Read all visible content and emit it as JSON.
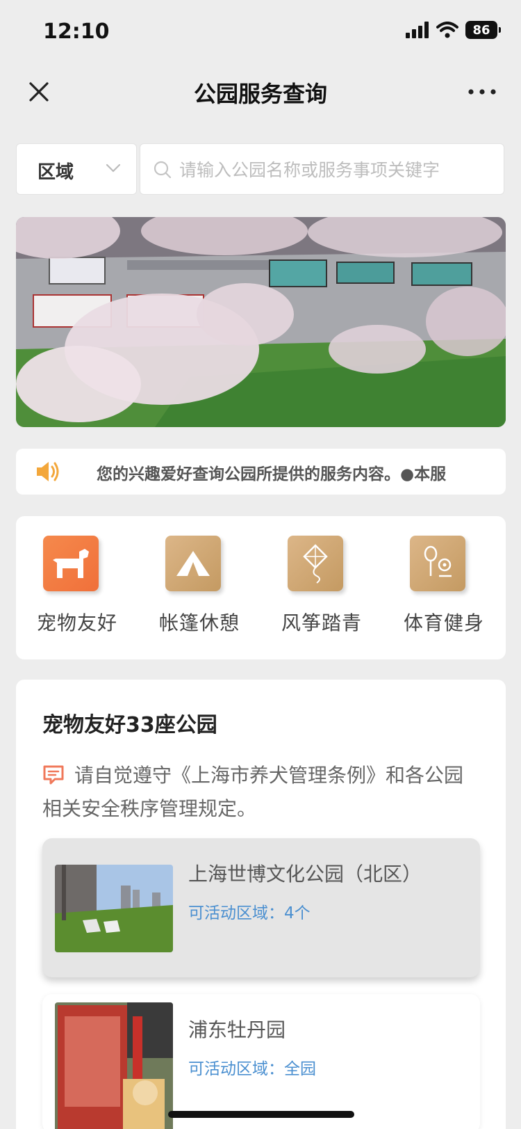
{
  "status_bar": {
    "time": "12:10",
    "battery": "86"
  },
  "nav": {
    "title": "公园服务查询"
  },
  "search": {
    "region_label": "区域",
    "placeholder": "请输入公园名称或服务事项关键字"
  },
  "notice": {
    "text": "您的兴趣爱好查询公园所提供的服务内容。●本服"
  },
  "categories": [
    {
      "label": "宠物友好",
      "icon": "dog-icon",
      "color": "#f27a40"
    },
    {
      "label": "帐篷休憩",
      "icon": "tent-icon",
      "color": "#cfa672"
    },
    {
      "label": "风筝踏青",
      "icon": "kite-icon",
      "color": "#cfa672"
    },
    {
      "label": "体育健身",
      "icon": "sports-icon",
      "color": "#cfa672"
    }
  ],
  "list": {
    "title": "宠物友好33座公园",
    "rules": "请自觉遵守《上海市养犬管理条例》和各公园相关安全秩序管理规定。",
    "parks": [
      {
        "name": "上海世博文化公园（北区）",
        "area": "可活动区域：4个"
      },
      {
        "name": "浦东牡丹园",
        "area": "可活动区域：全园"
      }
    ]
  },
  "colors": {
    "accent_orange": "#f27a40",
    "accent_gold": "#cfa672",
    "link_blue": "#4a8fd0",
    "background": "#ededed"
  }
}
